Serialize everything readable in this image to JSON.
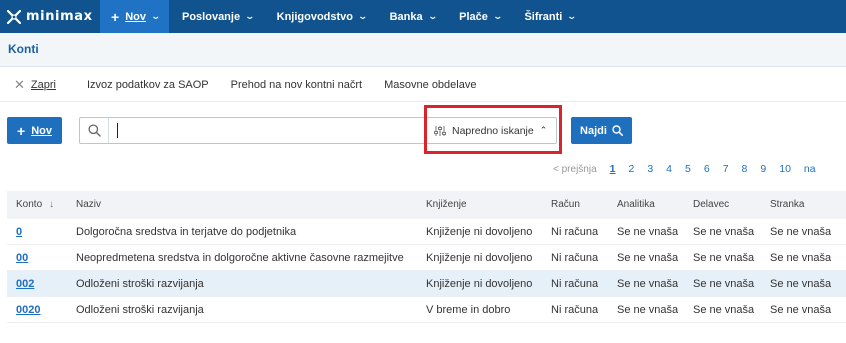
{
  "app": {
    "logo_text": "minimax"
  },
  "topnav": {
    "new_label": "Nov",
    "items": [
      {
        "label": "Poslovanje"
      },
      {
        "label": "Knjigovodstvo"
      },
      {
        "label": "Banka"
      },
      {
        "label": "Plače"
      },
      {
        "label": "Šifranti"
      }
    ]
  },
  "page": {
    "title": "Konti"
  },
  "toolbar": {
    "close_label": "Zapri",
    "export_label": "Izvoz podatkov za SAOP",
    "switch_label": "Prehod na nov kontni načrt",
    "bulk_label": "Masovne obdelave"
  },
  "search": {
    "new_button_label": "Nov",
    "value": "",
    "placeholder": "",
    "advanced_label": "Napredno iskanje",
    "find_label": "Najdi"
  },
  "pagination": {
    "prev_label": "< prejšnja",
    "current": "1",
    "pages": [
      "1",
      "2",
      "3",
      "4",
      "5",
      "6",
      "7",
      "8",
      "9",
      "10",
      "na"
    ]
  },
  "table": {
    "headers": {
      "konto": "Konto",
      "naziv": "Naziv",
      "knjizenje": "Knjiženje",
      "racun": "Račun",
      "analitika": "Analitika",
      "delavec": "Delavec",
      "stranka": "Stranka"
    },
    "rows": [
      {
        "konto": "0",
        "naziv": "Dolgoročna sredstva in terjatve do podjetnika",
        "knjizenje": "Knjiženje ni dovoljeno",
        "racun": "Ni računa",
        "analitika": "Se ne vnaša",
        "delavec": "Se ne vnaša",
        "stranka": "Se ne vnaša"
      },
      {
        "konto": "00",
        "naziv": "Neopredmetena sredstva in dolgoročne aktivne časovne razmejitve",
        "knjizenje": "Knjiženje ni dovoljeno",
        "racun": "Ni računa",
        "analitika": "Se ne vnaša",
        "delavec": "Se ne vnaša",
        "stranka": "Se ne vnaša"
      },
      {
        "konto": "002",
        "naziv": "Odloženi stroški razvijanja",
        "knjizenje": "Knjiženje ni dovoljeno",
        "racun": "Ni računa",
        "analitika": "Se ne vnaša",
        "delavec": "Se ne vnaša",
        "stranka": "Se ne vnaša"
      },
      {
        "konto": "0020",
        "naziv": "Odloženi stroški razvijanja",
        "knjizenje": "V breme in dobro",
        "racun": "Ni računa",
        "analitika": "Se ne vnaša",
        "delavec": "Se ne vnaša",
        "stranka": "Se ne vnaša"
      }
    ]
  },
  "colors": {
    "nav_bg": "#10538f",
    "accent": "#1f6fbf",
    "highlight": "#d9242b",
    "selected_row": "#e6f0f8"
  },
  "icons": {
    "logo": "minimax-logo-icon",
    "search": "search-icon",
    "filter": "sliders-icon",
    "find": "search-icon",
    "close": "close-icon",
    "sort": "sort-down-icon"
  }
}
